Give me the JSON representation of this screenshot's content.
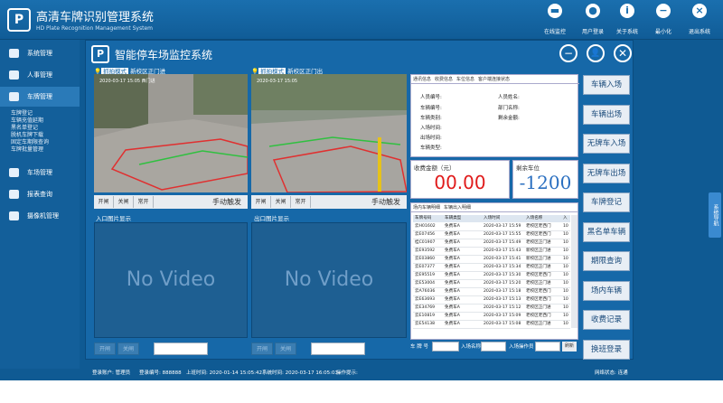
{
  "app": {
    "title": "高清车牌识别管理系统",
    "subtitle": "HD Plate Recognition Management System",
    "logo": "P"
  },
  "toolbar": [
    {
      "label": "在线监控",
      "icon": "car-icon"
    },
    {
      "label": "用户登录",
      "icon": "user-icon"
    },
    {
      "label": "关于系统",
      "icon": "info-icon"
    },
    {
      "label": "最小化",
      "icon": "minimize-icon"
    },
    {
      "label": "退出系统",
      "icon": "close-icon"
    }
  ],
  "sidebar": {
    "items": [
      {
        "label": "系统管理"
      },
      {
        "label": "人事管理"
      },
      {
        "label": "车牌管理"
      },
      {
        "label": "车场管理"
      },
      {
        "label": "报表查询"
      },
      {
        "label": "摄像机管理"
      }
    ],
    "subitems": [
      "车牌登记",
      "车辆充值延期",
      "黑名单登记",
      "脱机车牌下载",
      "固定车期限查询",
      "车牌批量管理"
    ]
  },
  "right_tab": "系统导航",
  "modal": {
    "title": "智能停车场监控系统",
    "controls": [
      "−",
      "👤",
      "✕"
    ],
    "entry_cam": {
      "mode": "抓拍模式",
      "name": "新校区正门进",
      "overlay": "2020-03-17 15:05  西门进"
    },
    "exit_cam": {
      "mode": "抓拍模式",
      "name": "新校区正门出",
      "overlay": "2020-03-17 15:05"
    },
    "gate_buttons": [
      "开闸",
      "关闸",
      "常开"
    ],
    "trigger": "手动触发",
    "entry_photo_label": "入口图片显示",
    "exit_photo_label": "出口图片显示",
    "no_video": "No Video",
    "ctrl_buttons": [
      "开闸",
      "关闸"
    ]
  },
  "info": {
    "tabs": [
      "通讯信息",
      "收费信息",
      "车位信息",
      "客户端连接状态"
    ],
    "fields_left": [
      "人员编号:",
      "车辆编号:",
      "车辆类别:",
      "入场时间:",
      "出场时间:",
      "车辆类型:"
    ],
    "fields_right": [
      "人员姓名:",
      "部门名称:",
      "剩余金额:"
    ]
  },
  "fee": {
    "label": "收费金额（元）",
    "value": "00.00",
    "color": "#e01b1b"
  },
  "spaces": {
    "label": "剩余车位",
    "value": "-1200",
    "color": "#2a6fc0"
  },
  "table": {
    "tabs": [
      "场内车辆明细",
      "车辆出入明细"
    ],
    "headers": [
      "车牌号码",
      "车辆类型",
      "入场时间",
      "入场名称",
      "入"
    ],
    "rows": [
      [
        "云H01602",
        "免费车A",
        "2020-03-17  15:59",
        "老校区老西门",
        "10"
      ],
      [
        "云E07456",
        "免费车A",
        "2020-03-17  15:55",
        "老校区老西门",
        "10"
      ],
      [
        "桂C01907",
        "免费车A",
        "2020-03-17  15:49",
        "老校区正门进",
        "10"
      ],
      [
        "云E93592",
        "免费车A",
        "2020-03-17  15:43",
        "新校区正门进",
        "10"
      ],
      [
        "云E03860",
        "免费车A",
        "2020-03-17  15:41",
        "新校区正门进",
        "10"
      ],
      [
        "云E07377",
        "免费车A",
        "2020-03-17  15:34",
        "老校区正门进",
        "10"
      ],
      [
        "云E95519",
        "免费车A",
        "2020-03-17  15:30",
        "老校区老西门",
        "10"
      ],
      [
        "云E53004",
        "免费车A",
        "2020-03-17  15:20",
        "老校区正门进",
        "10"
      ],
      [
        "云A76036",
        "免费车A",
        "2020-03-17  15:18",
        "老校区老西门",
        "10"
      ],
      [
        "云E63693",
        "免费车A",
        "2020-03-17  15:13",
        "老校区老西门",
        "10"
      ],
      [
        "云E34769",
        "免费车A",
        "2020-03-17  15:12",
        "老校区正门进",
        "10"
      ],
      [
        "云E10819",
        "免费车A",
        "2020-03-17  15:09",
        "老校区老西门",
        "10"
      ],
      [
        "云E54138",
        "免费车A",
        "2020-03-17  15:08",
        "老校区正门进",
        "10"
      ]
    ]
  },
  "filter": {
    "plate_label": "车 牌 号",
    "entry_name": "入场名称",
    "entry_type": "入场操作员",
    "button": "刷新"
  },
  "actions": [
    "车辆入场",
    "车辆出场",
    "无牌车入场",
    "无牌车出场",
    "车牌登记",
    "黑名单车辆",
    "期限查询",
    "场内车辆",
    "收费记录",
    "换班登录"
  ],
  "status": [
    "登录账户: 管理员",
    "登录编号: 888888",
    "上班时间: 2020-01-14  15:05:42",
    "系统时间: 2020-03-17  16:05:03",
    "操作提示:",
    "网络状态: 连通"
  ]
}
